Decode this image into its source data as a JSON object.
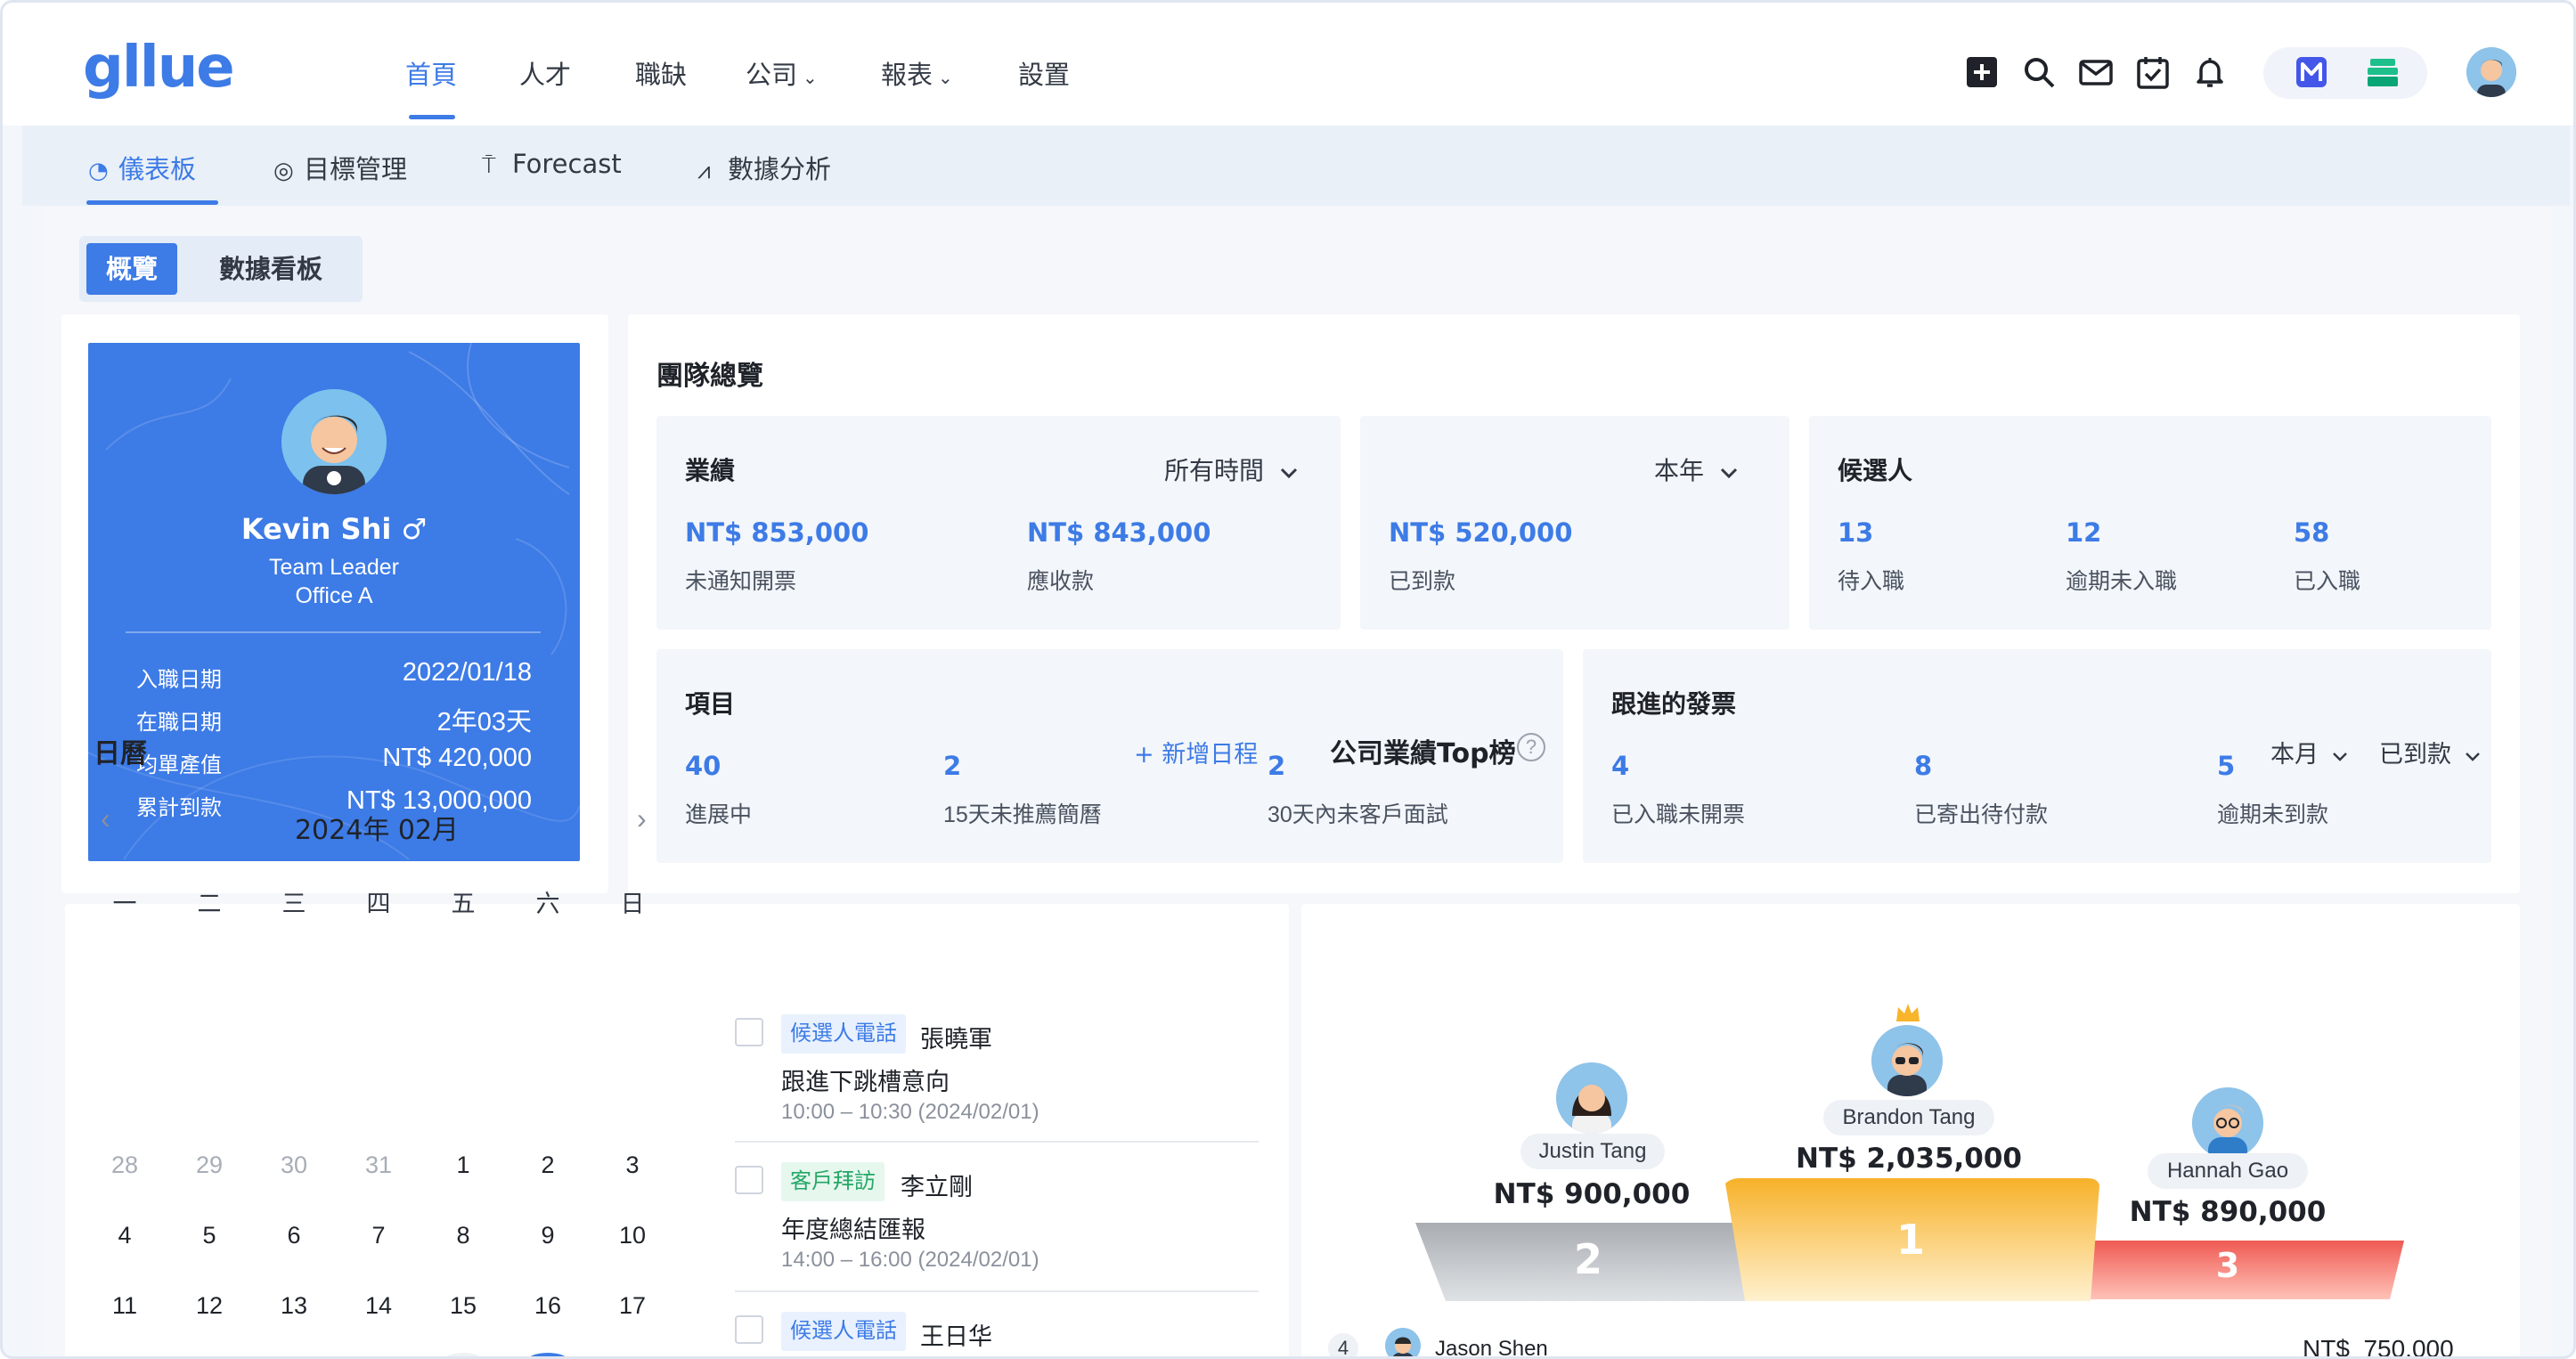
{
  "topnav": {
    "logo": "gllue",
    "items": [
      {
        "label": "首頁"
      },
      {
        "label": "人才"
      },
      {
        "label": "職缺"
      },
      {
        "label": "公司"
      },
      {
        "label": "報表"
      },
      {
        "label": "設置"
      }
    ],
    "caret": "⌄"
  },
  "subnav": {
    "items": [
      {
        "label": "儀表板"
      },
      {
        "label": "目標管理"
      },
      {
        "label": "Forecast"
      },
      {
        "label": "數據分析"
      }
    ]
  },
  "segment": {
    "overview": "概覽",
    "board": "數據看板"
  },
  "profile": {
    "name": "Kevin Shi",
    "gender_symbol": "♂",
    "role": "Team Leader",
    "office": "Office A",
    "rows": [
      {
        "label": "入職日期",
        "value": "2022/01/18"
      },
      {
        "label": "在職日期",
        "value": "2年03天"
      },
      {
        "label": "均單產值",
        "value": "NT$ 420,000"
      },
      {
        "label": "累計到款",
        "value": "NT$ 13,000,000"
      }
    ]
  },
  "team": {
    "title": "團隊總覽",
    "performance": {
      "title": "業績",
      "filter": "所有時間",
      "stats": [
        {
          "value": "NT$ 853,000",
          "label": "未通知開票"
        },
        {
          "value": "NT$ 843,000",
          "label": "應收款"
        }
      ]
    },
    "received": {
      "filter": "本年",
      "stats": [
        {
          "value": "NT$ 520,000",
          "label": "已到款"
        }
      ]
    },
    "candidates": {
      "title": "候選人",
      "stats": [
        {
          "value": "13",
          "label": "待入職"
        },
        {
          "value": "12",
          "label": "逾期未入職"
        },
        {
          "value": "58",
          "label": "已入職"
        }
      ]
    },
    "projects": {
      "title": "項目",
      "stats": [
        {
          "value": "40",
          "label": "進展中"
        },
        {
          "value": "2",
          "label": "15天未推薦簡曆"
        },
        {
          "value": "2",
          "label": "30天內未客戶面試"
        }
      ]
    },
    "invoices": {
      "title": "跟進的發票",
      "stats": [
        {
          "value": "4",
          "label": "已入職未開票"
        },
        {
          "value": "8",
          "label": "已寄出待付款"
        },
        {
          "value": "5",
          "label": "逾期未到款"
        }
      ]
    }
  },
  "calendar": {
    "title": "日曆",
    "add_label": "+ 新增日程",
    "month": "2024年 02月",
    "prev": "‹",
    "next": "›",
    "weekdays": [
      "一",
      "二",
      "三",
      "四",
      "五",
      "六",
      "日"
    ],
    "weeks": [
      [
        "28",
        "29",
        "30",
        "31",
        "1",
        "2",
        "3"
      ],
      [
        "4",
        "5",
        "6",
        "7",
        "8",
        "9",
        "10"
      ],
      [
        "11",
        "12",
        "13",
        "14",
        "15",
        "16",
        "17"
      ]
    ],
    "events": [
      {
        "tag": "候選人電話",
        "tag_color": "blue",
        "who": "張曉軍",
        "title": "跟進下跳槽意向",
        "time": "10:00 – 10:30 (2024/02/01)"
      },
      {
        "tag": "客戶拜訪",
        "tag_color": "green",
        "who": "李立剛",
        "title": "年度總結匯報",
        "time": "14:00 – 16:00 (2024/02/01)"
      },
      {
        "tag": "候選人電話",
        "tag_color": "blue",
        "who": "王日华"
      }
    ]
  },
  "ranking": {
    "title": "公司業績Top榜",
    "help": "?",
    "filter_period": "本月",
    "filter_type": "已到款",
    "first": {
      "rank": "1",
      "name": "Brandon Tang",
      "amount": "NT$ 2,035,000"
    },
    "second": {
      "rank": "2",
      "name": "Justin Tang",
      "amount": "NT$ 900,000"
    },
    "third": {
      "rank": "3",
      "name": "Hannah Gao",
      "amount": "NT$ 890,000"
    },
    "list": [
      {
        "rank": "4",
        "name": "Jason Shen",
        "amount": "NT$  750,000"
      }
    ]
  },
  "colors": {
    "accent": "#3d7be6",
    "gold": "#f8b42a",
    "silver": "#bfc3c8",
    "bronze": "#f06b60",
    "tag_green": "#22a765"
  }
}
